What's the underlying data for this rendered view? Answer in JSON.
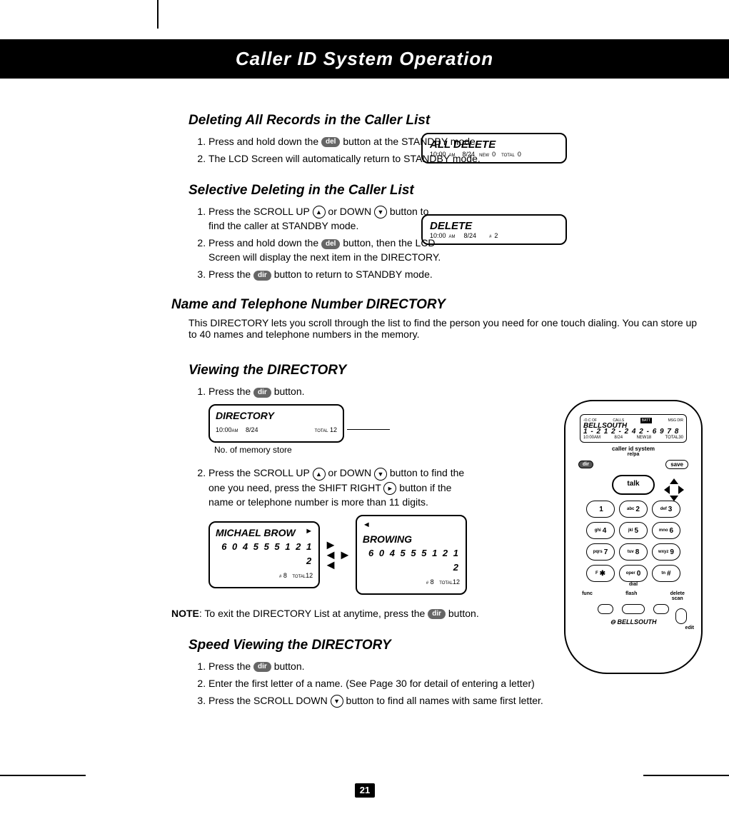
{
  "header": {
    "title": "Caller ID System Operation"
  },
  "sections": {
    "del_all": {
      "heading": "Deleting All Records in the Caller List",
      "step1a": "Press and hold down the",
      "step1b": "button at the STANDBY mode.",
      "step2": "The LCD Screen will automatically return to STANDBY mode."
    },
    "sel_del": {
      "heading": "Selective Deleting in the Caller List",
      "step1a": "Press the SCROLL UP",
      "step1b": "or DOWN",
      "step1c": "button to find the caller at STANDBY mode.",
      "step2a": "Press and hold down the",
      "step2b": "button, then the LCD Screen will display the next item in the DIRECTORY.",
      "step3a": "Press the",
      "step3b": "button to return to STANDBY mode."
    },
    "name_dir": {
      "heading": "Name and Telephone Number DIRECTORY",
      "intro": "This DIRECTORY lets you scroll through the list to find the person you need for one touch dialing. You can store up to 40 names and telephone numbers in the memory."
    },
    "view_dir": {
      "heading": "Viewing the DIRECTORY",
      "step1a": "Press the",
      "step1b": "button.",
      "step2a": "Press the SCROLL UP",
      "step2b": "or DOWN",
      "step2c": "button to find the one you need, press the SHIFT RIGHT",
      "step2d": "button if the name or telephone number is more than 11 digits.",
      "caption": "No. of memory store"
    },
    "note": {
      "bold": "NOTE",
      "text1": ":  To exit the DIRECTORY List at anytime, press the",
      "text2": "button."
    },
    "speed": {
      "heading": "Speed Viewing the DIRECTORY",
      "step1a": "Press the",
      "step1b": "button.",
      "step2": "Enter the first letter of a name. (See Page 30 for detail of entering a letter)",
      "step3a": "Press the SCROLL DOWN",
      "step3b": "button to find all names with same first letter."
    }
  },
  "buttons": {
    "del": "del",
    "dir": "dir",
    "up": "▲",
    "down": "▼",
    "right": "►",
    "left": "◄"
  },
  "lcd": {
    "all_delete": {
      "title": "ALL DELETE",
      "time": "10:00",
      "ampm": "AM",
      "date": "8/24",
      "new_lbl": "NEW",
      "new": "0",
      "total_lbl": "TOTAL",
      "total": "0"
    },
    "delete": {
      "title": "DELETE",
      "time": "10:00",
      "ampm": "AM",
      "date": "8/24",
      "hash": "#",
      "num": "2"
    },
    "directory": {
      "title": "DIRECTORY",
      "time": "10:00",
      "ampm": "AM",
      "date": "8/24",
      "total_lbl": "TOTAL",
      "total": "12"
    },
    "name_left": {
      "name": "MICHAEL BROW",
      "num": "6 0 4 5 5 5 1 2 1 2",
      "hash": "#",
      "idx": "8",
      "total_lbl": "TOTAL",
      "total": "12",
      "corner": "►"
    },
    "name_right": {
      "name": "BROWING",
      "num": "6 0 4 5 5 5 1 2 1 2",
      "hash": "#",
      "idx": "8",
      "total_lbl": "TOTAL",
      "total": "12",
      "corner": "◄"
    }
  },
  "phone": {
    "indicators": {
      "l": "-O.C OF",
      "m": "CALLS",
      "bat": "BATT",
      "r": "MSG DIR"
    },
    "name": "BELLSOUTH",
    "number": "1 - 2 1 2 - 2 4 2 - 6 9 7 8",
    "row": {
      "time": "10:00",
      "ampm": "AM",
      "date": "8/24",
      "new_lbl": "NEW",
      "new": "18",
      "total_lbl": "TOTAL",
      "total": "30"
    },
    "sub": "caller id system",
    "repa": "re/pa",
    "save": "save",
    "dir": "dir",
    "talk": "talk",
    "keys": [
      {
        "l": "",
        "n": "1"
      },
      {
        "l": "abc",
        "n": "2"
      },
      {
        "l": "def",
        "n": "3"
      },
      {
        "l": "ghi",
        "n": "4"
      },
      {
        "l": "jkl",
        "n": "5"
      },
      {
        "l": "mno",
        "n": "6"
      },
      {
        "l": "pqrs",
        "n": "7"
      },
      {
        "l": "tuv",
        "n": "8"
      },
      {
        "l": "wxyz",
        "n": "9"
      },
      {
        "l": "F",
        "n": "✱"
      },
      {
        "l": "oper",
        "n": "0"
      },
      {
        "l": "tn",
        "n": "#"
      }
    ],
    "dial": "dial",
    "small": {
      "func": "func",
      "flash": "flash",
      "delete": "delete",
      "scan": "scan",
      "edit": "edit"
    },
    "logo": "⊖ BELLSOUTH"
  },
  "page_number": "21"
}
